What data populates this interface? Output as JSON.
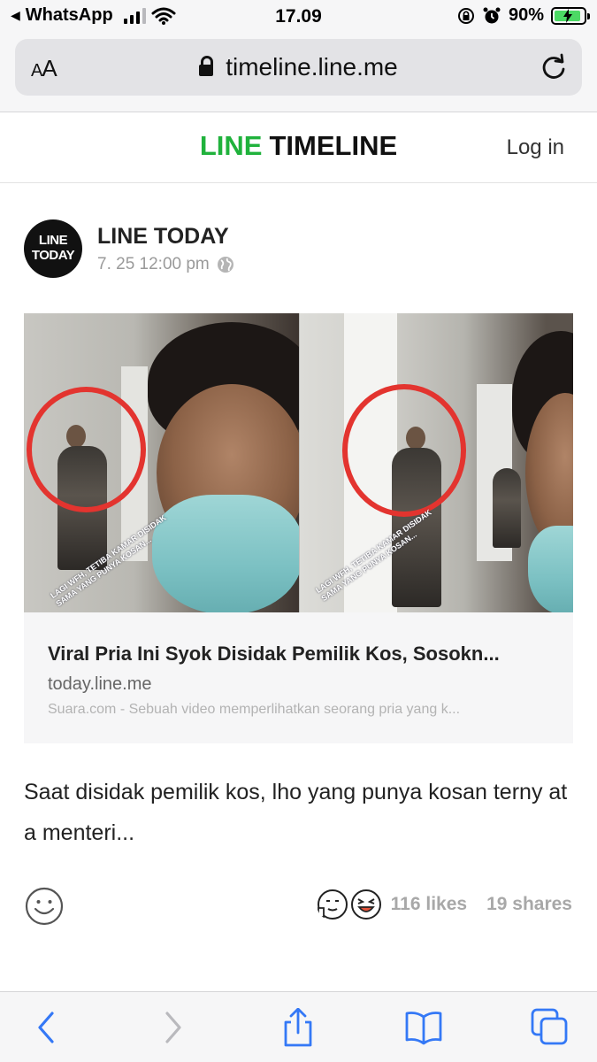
{
  "status_bar": {
    "back_app": "WhatsApp",
    "time": "17.09",
    "battery_percent": "90%",
    "battery_level": 0.9,
    "signal_bars": 3,
    "colors": {
      "battery_fill": "#4cd964"
    }
  },
  "browser": {
    "text_size_label": "AA",
    "url": "timeline.line.me",
    "icons": [
      "lock-icon",
      "reload-icon"
    ]
  },
  "header": {
    "brand_line": "LINE",
    "brand_timeline": "TIMELINE",
    "login_label": "Log in",
    "colors": {
      "brand_green": "#20b23c"
    }
  },
  "post": {
    "avatar_line1": "LINE",
    "avatar_line2": "TODAY",
    "author": "LINE TODAY",
    "timestamp": "7. 25 12:00 pm",
    "media_caption": "LAGI WFH, TETIBA KAMAR DISIDAK SAMA YANG PUNYA KOSAN...",
    "link_card": {
      "title": "Viral Pria Ini Syok Disidak Pemilik Kos, Sosokn...",
      "domain": "today.line.me",
      "description": "Suara.com - Sebuah video memperlihatkan seorang pria yang k..."
    },
    "text": "Saat disidak pemilik kos, lho yang punya kosan terny ata menteri...",
    "likes": "116 likes",
    "shares": "19 shares"
  },
  "toolbar": {
    "items": [
      "back-icon",
      "forward-icon",
      "share-icon",
      "bookmarks-icon",
      "tabs-icon"
    ],
    "colors": {
      "active": "#3478f6",
      "disabled": "#b9b9bd"
    }
  }
}
